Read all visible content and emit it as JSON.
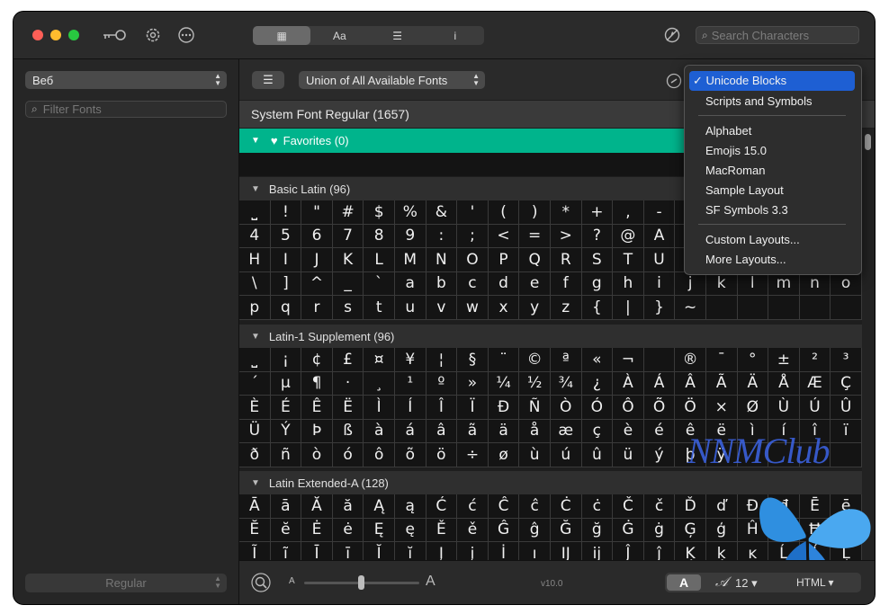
{
  "toolbar": {
    "view_tabs": [
      {
        "label": "▦",
        "icon": "grid-view-icon"
      },
      {
        "label": "Aa",
        "icon": "glyph-view-icon"
      },
      {
        "label": "☰",
        "icon": "text-view-icon"
      },
      {
        "label": "i",
        "icon": "info-view-icon"
      }
    ],
    "search_placeholder": "Search Characters"
  },
  "sidebar": {
    "collection_value": "Веб",
    "filter_placeholder": "Filter Fonts",
    "style_value": "Regular"
  },
  "main": {
    "font_source": "Union of All Available Fonts",
    "font_title": "System Font Regular (1657)",
    "favorites_label": "Favorites (0)",
    "sections": [
      {
        "label": "Basic Latin (96)"
      },
      {
        "label": "Latin-1 Supplement (96)"
      },
      {
        "label": "Latin Extended-A (128)"
      }
    ],
    "basic_latin": [
      "⎵",
      "!",
      "\"",
      "#",
      "$",
      "%",
      "&",
      "'",
      "(",
      ")",
      "*",
      "+",
      ",",
      "-",
      "",
      "",
      "",
      "",
      "",
      "",
      "4",
      "5",
      "6",
      "7",
      "8",
      "9",
      ":",
      ";",
      "<",
      "=",
      ">",
      "?",
      "@",
      "A",
      "",
      "",
      "",
      "",
      "",
      "",
      "H",
      "I",
      "J",
      "K",
      "L",
      "M",
      "N",
      "O",
      "P",
      "Q",
      "R",
      "S",
      "T",
      "U",
      "",
      "",
      "",
      "",
      "",
      "",
      "\\",
      "]",
      "^",
      "_",
      "`",
      "a",
      "b",
      "c",
      "d",
      "e",
      "f",
      "g",
      "h",
      "i",
      "j",
      "k",
      "l",
      "m",
      "n",
      "o",
      "p",
      "q",
      "r",
      "s",
      "t",
      "u",
      "v",
      "w",
      "x",
      "y",
      "z",
      "{",
      "|",
      "}",
      "~",
      "",
      "",
      "",
      "",
      ""
    ],
    "latin1": [
      "⎵",
      "¡",
      "¢",
      "£",
      "¤",
      "¥",
      "¦",
      "§",
      "¨",
      "©",
      "ª",
      "«",
      "¬",
      "",
      "®",
      "¯",
      "°",
      "±",
      "²",
      "³",
      "´",
      "µ",
      "¶",
      "·",
      "¸",
      "¹",
      "º",
      "»",
      "¼",
      "½",
      "¾",
      "¿",
      "À",
      "Á",
      "Â",
      "Ã",
      "Ä",
      "Å",
      "Æ",
      "Ç",
      "È",
      "É",
      "Ê",
      "Ë",
      "Ì",
      "Í",
      "Î",
      "Ï",
      "Ð",
      "Ñ",
      "Ò",
      "Ó",
      "Ô",
      "Õ",
      "Ö",
      "×",
      "Ø",
      "Ù",
      "Ú",
      "Û",
      "Ü",
      "Ý",
      "Þ",
      "ß",
      "à",
      "á",
      "â",
      "ã",
      "ä",
      "å",
      "æ",
      "ç",
      "è",
      "é",
      "ê",
      "ë",
      "ì",
      "í",
      "î",
      "ï",
      "ð",
      "ñ",
      "ò",
      "ó",
      "ô",
      "õ",
      "ö",
      "÷",
      "ø",
      "ù",
      "ú",
      "û",
      "ü",
      "ý",
      "þ",
      "ÿ",
      "",
      "",
      "",
      ""
    ],
    "latin_ext_a": [
      "Ā",
      "ā",
      "Ă",
      "ă",
      "Ą",
      "ą",
      "Ć",
      "ć",
      "Ĉ",
      "ĉ",
      "Ċ",
      "ċ",
      "Č",
      "č",
      "Ď",
      "ď",
      "Đ",
      "đ",
      "Ē",
      "ē",
      "Ĕ",
      "ĕ",
      "Ė",
      "ė",
      "Ę",
      "ę",
      "Ě",
      "ě",
      "Ĝ",
      "ĝ",
      "Ğ",
      "ğ",
      "Ġ",
      "ġ",
      "Ģ",
      "ģ",
      "Ĥ",
      "ĥ",
      "Ħ",
      "ħ",
      "Ĩ",
      "ĩ",
      "Ī",
      "ī",
      "Ĭ",
      "ĭ",
      "Į",
      "į",
      "İ",
      "ı",
      "Ĳ",
      "ĳ",
      "Ĵ",
      "ĵ",
      "Ķ",
      "ķ",
      "ĸ",
      "Ĺ",
      "ĺ",
      "Ļ"
    ]
  },
  "menu": {
    "items": [
      {
        "label": "✓ Unicode Blocks",
        "selected": true
      },
      {
        "label": "Scripts and Symbols"
      },
      {
        "label": "Alphabet"
      },
      {
        "label": "Emojis 15.0"
      },
      {
        "label": "MacRoman"
      },
      {
        "label": "Sample Layout"
      },
      {
        "label": "SF Symbols 3.3"
      },
      {
        "label": "Custom Layouts..."
      },
      {
        "label": "More Layouts..."
      }
    ]
  },
  "bottom": {
    "size_small": "A",
    "size_large": "A",
    "version": "v10.0",
    "display_mode": "A",
    "font_size": "12 ▾",
    "export_format": "HTML ▾"
  },
  "watermark": "NNMClub",
  "colors": {
    "favorites": "#00b48c",
    "menu_selected": "#1e5fd3"
  }
}
